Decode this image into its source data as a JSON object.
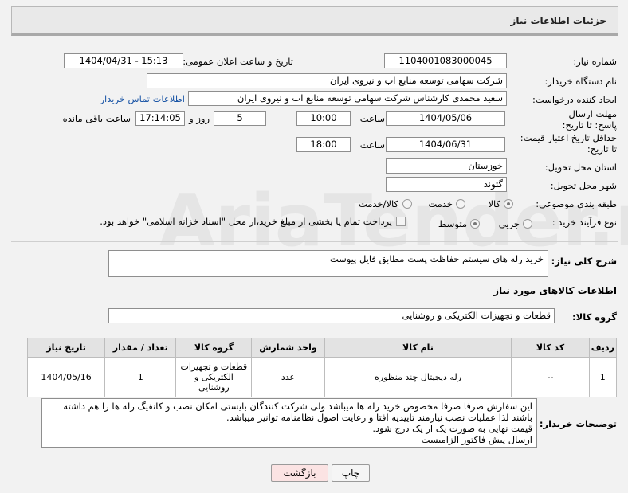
{
  "page_title": "جزئیات اطلاعات نیاز",
  "watermark": "AriaTender.net",
  "fields": {
    "need_number_label": "شماره نیاز:",
    "need_number": "1104001083000045",
    "announce_label": "تاریخ و ساعت اعلان عمومی:",
    "announce_value": "1404/04/31 - 15:13",
    "buyer_org_label": "نام دستگاه خریدار:",
    "buyer_org": "شرکت سهامی توسعه منابع اب و نیروی ایران",
    "creator_label": "ایجاد کننده درخواست:",
    "creator": "سعید محمدی کارشناس شرکت سهامی توسعه منابع اب و نیروی ایران",
    "contact_link": "اطلاعات تماس خریدار",
    "deadline_label": "مهلت ارسال پاسخ: تا تاریخ:",
    "deadline_date": "1404/05/06",
    "time_label": "ساعت",
    "deadline_time": "10:00",
    "days_value": "5",
    "days_label": "روز و",
    "remaining_time": "17:14:05",
    "remaining_label": "ساعت باقی مانده",
    "validity_label": "حداقل تاریخ اعتبار قیمت: تا تاریخ:",
    "validity_date": "1404/06/31",
    "validity_time": "18:00",
    "province_label": "استان محل تحویل:",
    "province": "خوزستان",
    "city_label": "شهر محل تحویل:",
    "city": "گتوند",
    "category_label": "طبقه بندی موضوعی:",
    "category_options": [
      "کالا",
      "خدمت",
      "کالا/خدمت"
    ],
    "process_label": "نوع فرآیند خرید :",
    "process_options": [
      "جزیی",
      "متوسط"
    ],
    "payment_note": "پرداخت تمام یا بخشی از مبلغ خرید،از محل \"اسناد خزانه اسلامی\" خواهد بود."
  },
  "description": {
    "label": "شرح کلی نیاز:",
    "value": "خرید رله های سیستم حفاظت پست مطابق فایل پیوست"
  },
  "goods_section_title": "اطلاعات کالاهای مورد نیاز",
  "goods_group": {
    "label": "گروه کالا:",
    "value": "قطعات و تجهیزات الکتریکی و روشنایی"
  },
  "table": {
    "headers": [
      "ردیف",
      "کد کالا",
      "نام کالا",
      "واحد شمارش",
      "گروه کالا",
      "تعداد / مقدار",
      "تاریخ نیاز"
    ],
    "rows": [
      [
        "1",
        "--",
        "رله دیجیتال چند منظوره",
        "عدد",
        "قطعات و تجهیزات الکتریکی و روشنایی",
        "1",
        "1404/05/16"
      ]
    ]
  },
  "buyer_notes": {
    "label": "توضیحات خریدار:",
    "lines": [
      "این سفارش صرفا صرفا مخصوص خرید رله ها میباشد ولی شرکت کنندگان بایستی امکان نصب و کانفیگ رله ها را هم داشته",
      "باشند لذا عملیات نصب نیازمند تاییدیه افتا و رعایت اصول نظامنامه توانیر میباشد.",
      "قیمت نهایی به صورت یک از یک درج شود.",
      "ارسال پیش فاکتور الزامیست"
    ]
  },
  "buttons": {
    "print": "چاپ",
    "back": "بازگشت"
  }
}
